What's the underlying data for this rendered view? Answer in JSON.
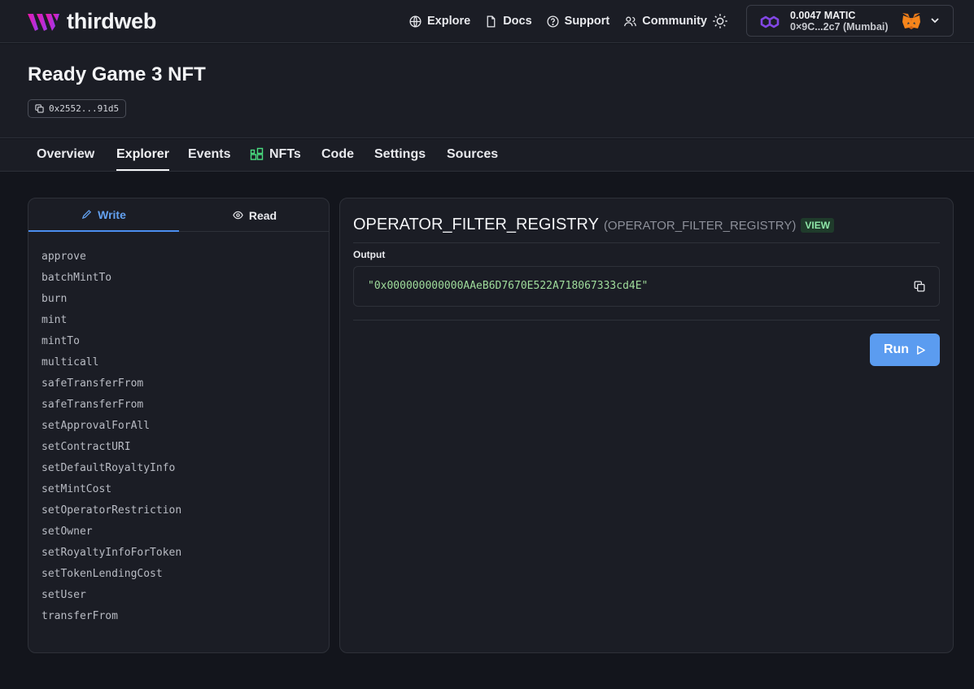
{
  "brand": {
    "name": "thirdweb",
    "accent": "#c026d3"
  },
  "nav": {
    "links": [
      {
        "label": "Explore",
        "icon": "globe-icon"
      },
      {
        "label": "Docs",
        "icon": "doc-icon"
      },
      {
        "label": "Support",
        "icon": "help-icon"
      },
      {
        "label": "Community",
        "icon": "users-icon"
      }
    ],
    "theme_icon": "sun-icon"
  },
  "wallet": {
    "balance": "0.0047 MATIC",
    "address": "0×9C...2c7 (Mumbai)",
    "network_icon": "polygon-icon",
    "wallet_icon": "metamask-fox-icon"
  },
  "contract": {
    "title": "Ready Game 3 NFT",
    "address_short": "0x2552...91d5"
  },
  "tabs": {
    "items": [
      "Overview",
      "Explorer",
      "Events",
      "NFTs",
      "Code",
      "Settings",
      "Sources"
    ],
    "active": "Explorer"
  },
  "functions_panel": {
    "write_label": "Write",
    "read_label": "Read",
    "active": "Write",
    "items": [
      "approve",
      "batchMintTo",
      "burn",
      "mint",
      "mintTo",
      "multicall",
      "safeTransferFrom",
      "safeTransferFrom",
      "setApprovalForAll",
      "setContractURI",
      "setDefaultRoyaltyInfo",
      "setMintCost",
      "setOperatorRestriction",
      "setOwner",
      "setRoyaltyInfoForToken",
      "setTokenLendingCost",
      "setUser",
      "transferFrom"
    ]
  },
  "detail": {
    "function_name": "OPERATOR_FILTER_REGISTRY",
    "function_sub": "(OPERATOR_FILTER_REGISTRY)",
    "badge": "VIEW",
    "output_label": "Output",
    "output_value": "\"0x000000000000AAeB6D7670E522A718067333cd4E\"",
    "run_label": "Run"
  }
}
